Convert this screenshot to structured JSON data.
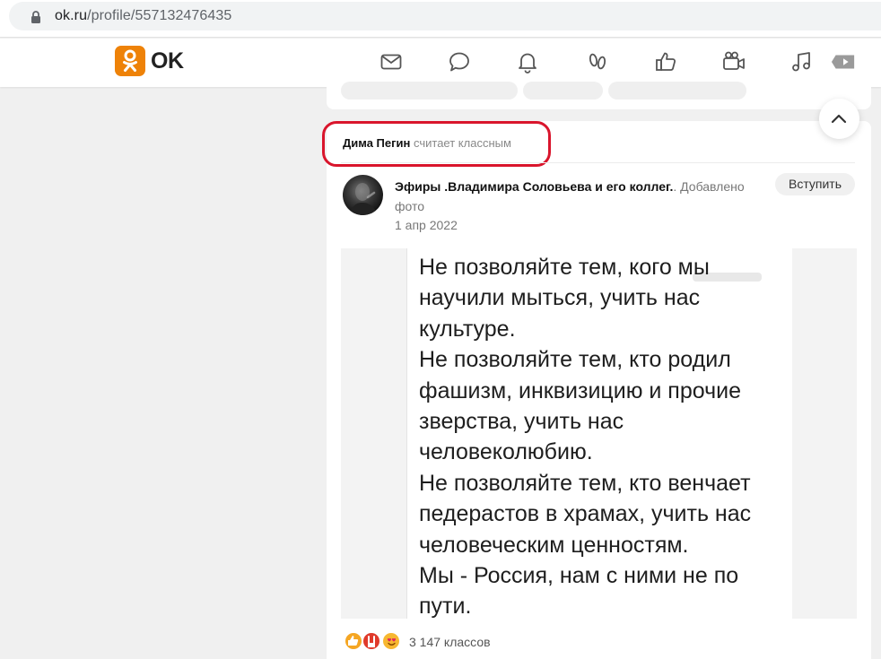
{
  "browser": {
    "url_host": "ok.ru",
    "url_path": "/profile/557132476435"
  },
  "header": {
    "logo_text": "OK",
    "nav_icons": [
      "mail-icon",
      "chat-icon",
      "bell-icon",
      "guests-icon",
      "like-icon",
      "video-camera-icon",
      "music-icon",
      "video-icon"
    ]
  },
  "post": {
    "liker_name": "Дима Пегин",
    "liker_action": "считает классным",
    "group_name": "Эфиры .Владимира Соловьева и его коллег.",
    "group_action": ". Добавлено фото",
    "date": "1 апр 2022",
    "join_label": "Вступить",
    "photo_lines": [
      "Не позволяйте тем, кого мы",
      "научили мыться, учить нас",
      "культуре.",
      "Не позволяйте тем, кто родил",
      "фашизм, инквизицию и прочие",
      "зверства, учить нас",
      "человеколюбию.",
      "Не позволяйте тем, кто венчает",
      "педерастов в храмах, учить нас",
      "человеческим ценностям.",
      "Мы - Россия, нам с ними не по",
      "пути."
    ],
    "reactions_count": "3 147 классов"
  },
  "colors": {
    "brand": "#ee8208",
    "highlight": "#d9152c"
  }
}
